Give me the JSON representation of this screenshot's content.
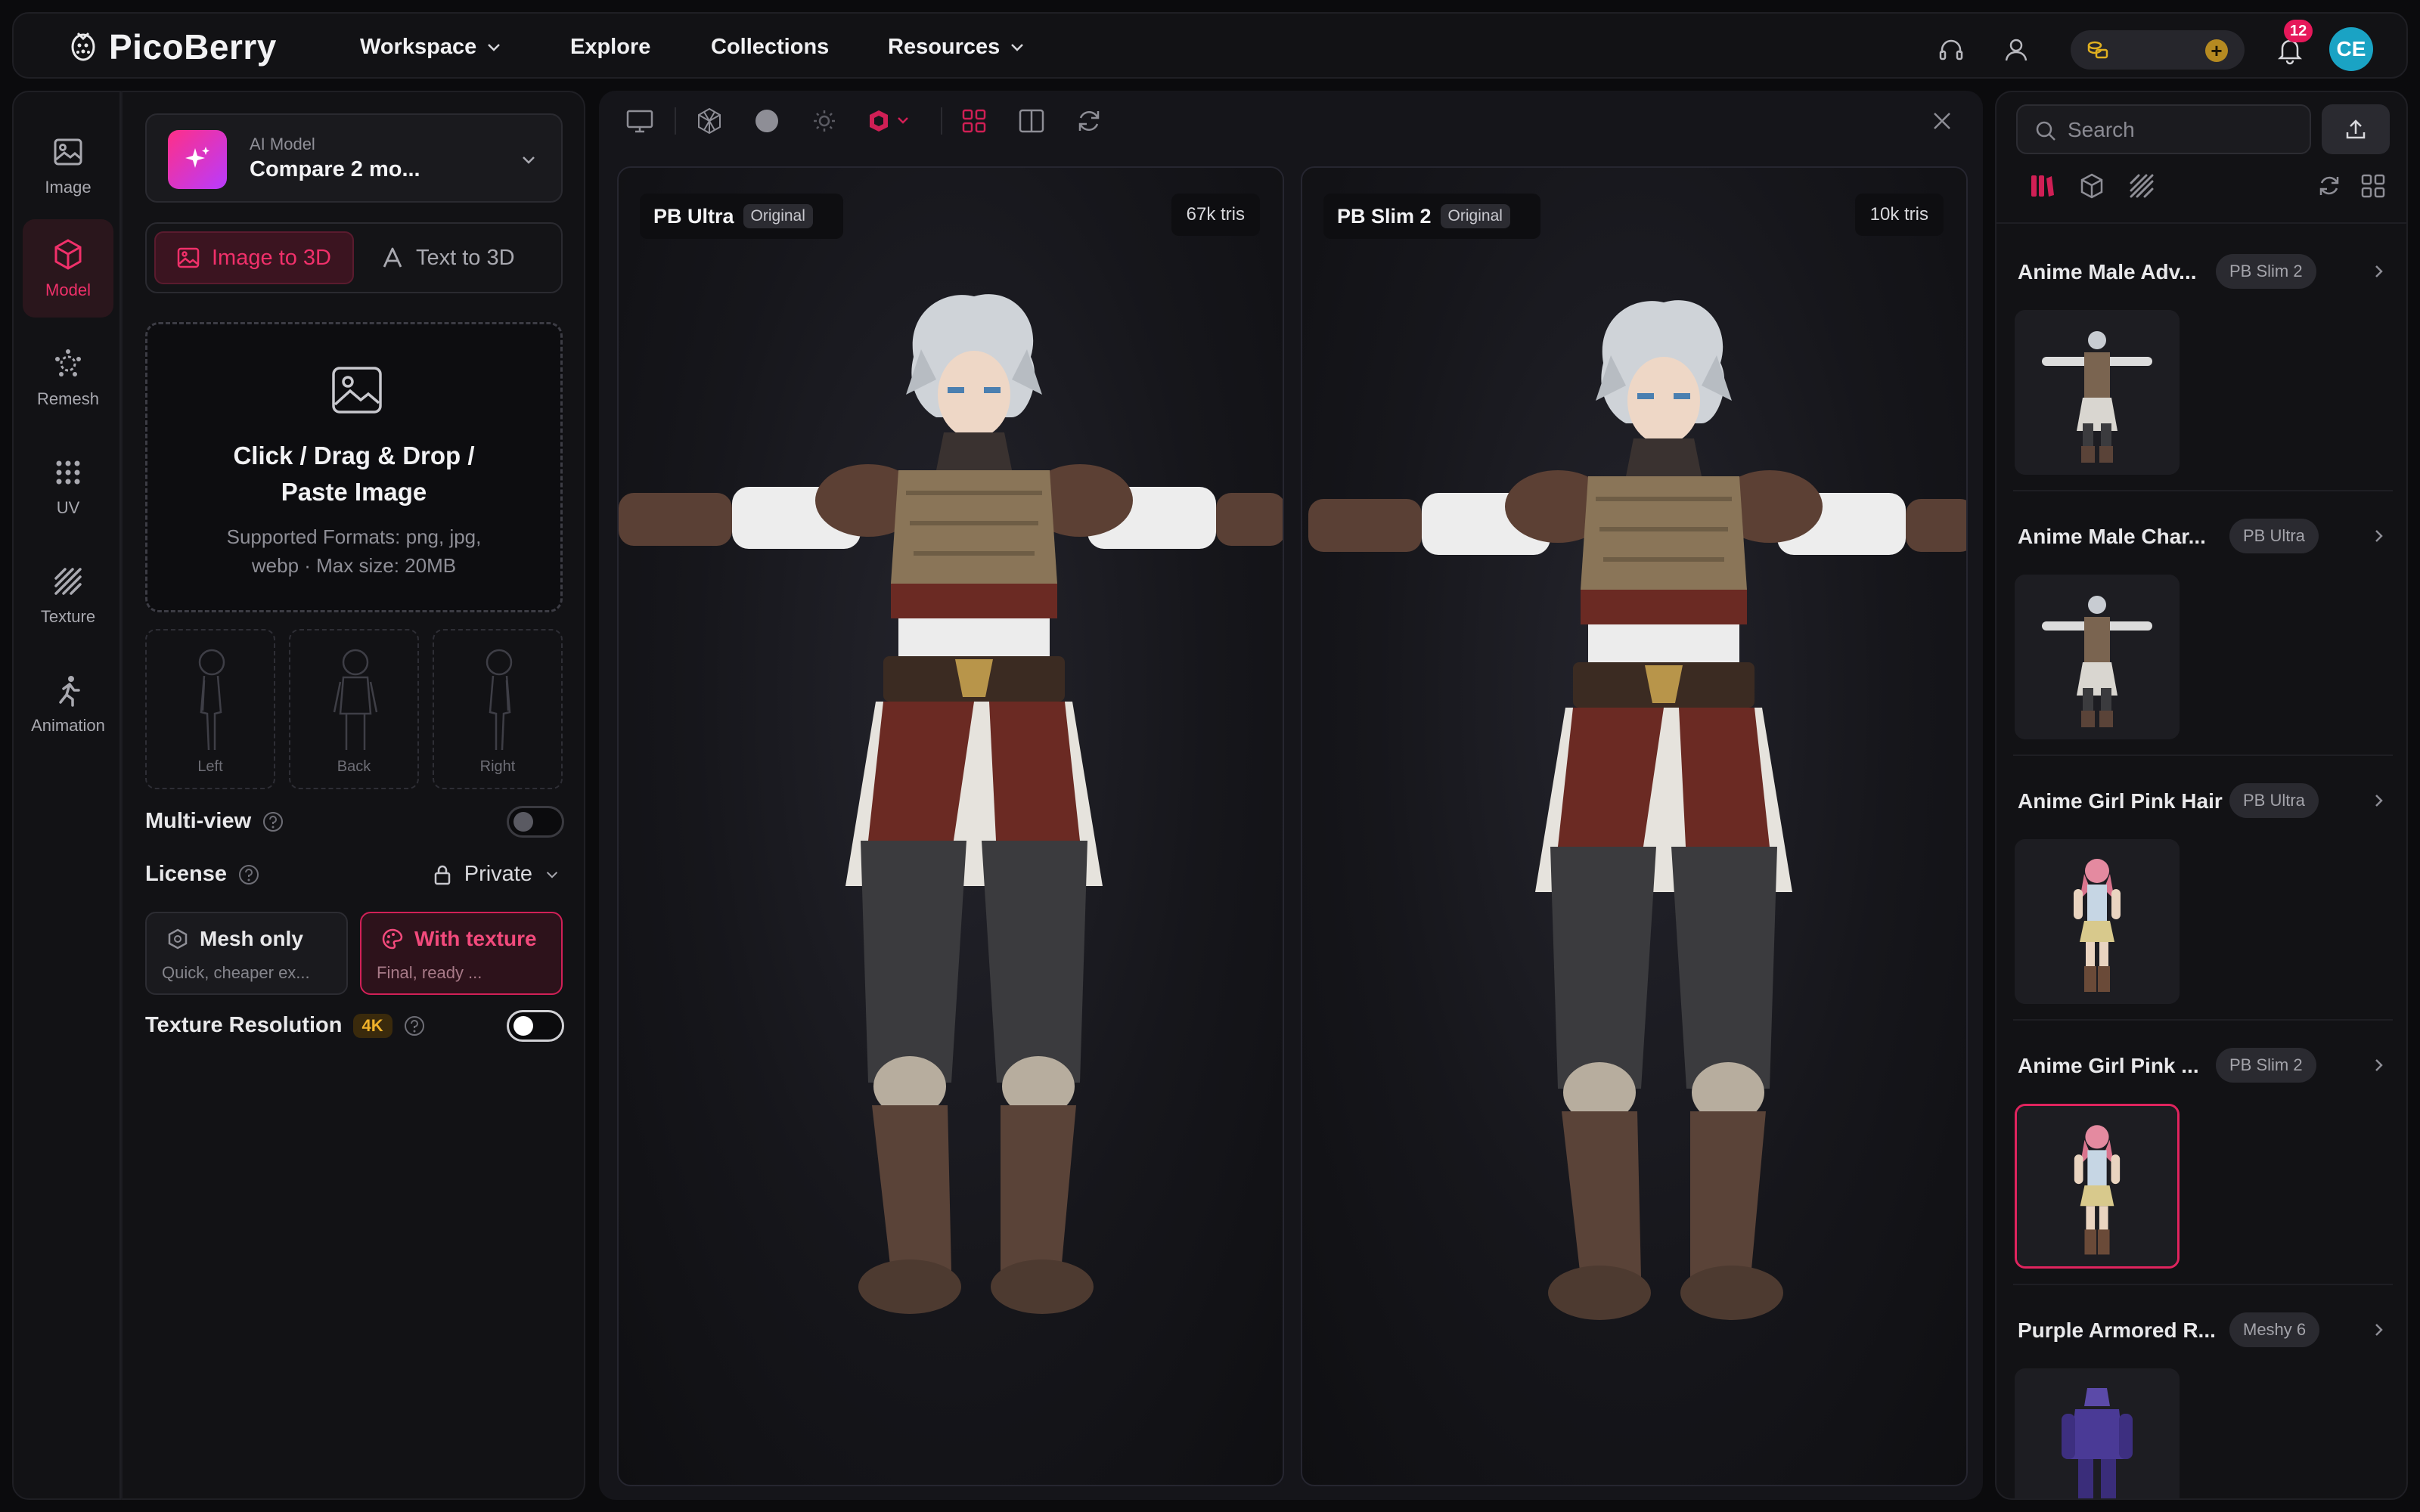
{
  "app": {
    "name": "PicoBerry",
    "nav": [
      {
        "label": "Workspace",
        "dropdown": true
      },
      {
        "label": "Explore",
        "dropdown": false
      },
      {
        "label": "Collections",
        "dropdown": false
      },
      {
        "label": "Resources",
        "dropdown": true
      }
    ],
    "notification_count": "12",
    "avatar_initials": "CE",
    "icons": [
      "headset-icon",
      "user-icon",
      "coin-stack-icon",
      "plus-icon",
      "bell-icon"
    ]
  },
  "rail": [
    {
      "key": "image",
      "label": "Image",
      "icon": "image-icon",
      "active": false
    },
    {
      "key": "model",
      "label": "Model",
      "icon": "cube-icon",
      "active": true
    },
    {
      "key": "remesh",
      "label": "Remesh",
      "icon": "remesh-icon",
      "active": false
    },
    {
      "key": "uv",
      "label": "UV",
      "icon": "uv-grid-icon",
      "active": false
    },
    {
      "key": "texture",
      "label": "Texture",
      "icon": "texture-stripes-icon",
      "active": false
    },
    {
      "key": "animation",
      "label": "Animation",
      "icon": "running-figure-icon",
      "active": false
    }
  ],
  "panel": {
    "model_caption": "AI Model",
    "model_value": "Compare 2 mo...",
    "tabs": {
      "image_to_3d": "Image to 3D",
      "text_to_3d": "Text to 3D"
    },
    "dropzone": {
      "title_line1": "Click / Drag & Drop /",
      "title_line2": "Paste Image",
      "sub_line1": "Supported Formats: png, jpg,",
      "sub_line2": "webp · Max size: 20MB"
    },
    "views": [
      "Left",
      "Back",
      "Right"
    ],
    "multiview_label": "Multi-view",
    "multiview_on": false,
    "license_label": "License",
    "license_value": "Private",
    "options": {
      "mesh_title": "Mesh only",
      "mesh_sub": "Quick, cheaper ex...",
      "texture_title": "With texture",
      "texture_sub": "Final, ready ..."
    },
    "texture_res_label": "Texture Resolution",
    "texture_res_badge": "4K",
    "texture_res_on": true
  },
  "viewer": {
    "toolbar_icons": [
      "monitor-icon",
      "wireframe-sphere-icon",
      "solid-sphere-icon",
      "light-icon",
      "material-icon",
      "grid-view-icon",
      "split-view-icon",
      "refresh-icon",
      "close-icon"
    ],
    "panes": [
      {
        "name": "PB Ultra",
        "tag": "Original",
        "tris": "67k tris"
      },
      {
        "name": "PB Slim 2",
        "tag": "Original",
        "tris": "10k tris"
      }
    ]
  },
  "history": {
    "search_placeholder": "Search",
    "items": [
      {
        "title": "Anime Male Adv...",
        "badge": "PB Slim 2",
        "thumb": "male",
        "selected": false
      },
      {
        "title": "Anime Male Char...",
        "badge": "PB Ultra",
        "thumb": "male",
        "selected": false
      },
      {
        "title": "Anime Girl Pink Hair",
        "badge": "PB Ultra",
        "thumb": "girl",
        "selected": false
      },
      {
        "title": "Anime Girl Pink ...",
        "badge": "PB Slim 2",
        "thumb": "girl",
        "selected": true
      },
      {
        "title": "Purple Armored R...",
        "badge": "Meshy 6",
        "thumb": "armor",
        "selected": false
      }
    ]
  },
  "colors": {
    "accent": "#f0306a",
    "bg": "#0b0b0d",
    "panel": "#121215",
    "coin": "#e0b020"
  }
}
